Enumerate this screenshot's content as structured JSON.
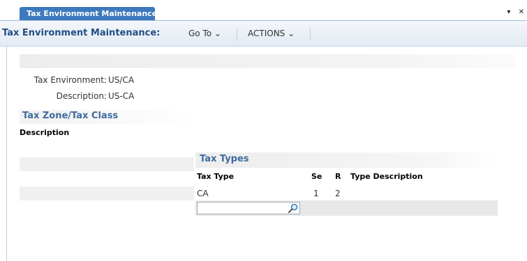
{
  "tab": {
    "label": "Tax Environment Maintenance",
    "controls": "▾ ✕"
  },
  "toolbar": {
    "title": "Tax Environment Maintenance:",
    "goto_label": "Go To ⌄",
    "actions_label": "ACTIONS ⌄"
  },
  "form": {
    "tax_environment": {
      "label": "Tax Environment:",
      "value": "US/CA"
    },
    "description": {
      "label": "Description:",
      "value": "US-CA"
    }
  },
  "tax_zone": {
    "title": "Tax Zone/Tax Class",
    "header": "Description"
  },
  "tax_types": {
    "title": "Tax Types",
    "columns": [
      "Tax Type",
      "Se",
      "R",
      "Type Description"
    ],
    "rows": [
      {
        "tax_type": "CA",
        "se": "1",
        "r": "2",
        "type_description": ""
      }
    ],
    "search": {
      "value": "",
      "placeholder": ""
    }
  },
  "icons": {
    "search": "magnifier-icon"
  },
  "colors": {
    "accent": "#3d79bd",
    "title": "#1f4f86",
    "section": "#3d6c9f"
  }
}
